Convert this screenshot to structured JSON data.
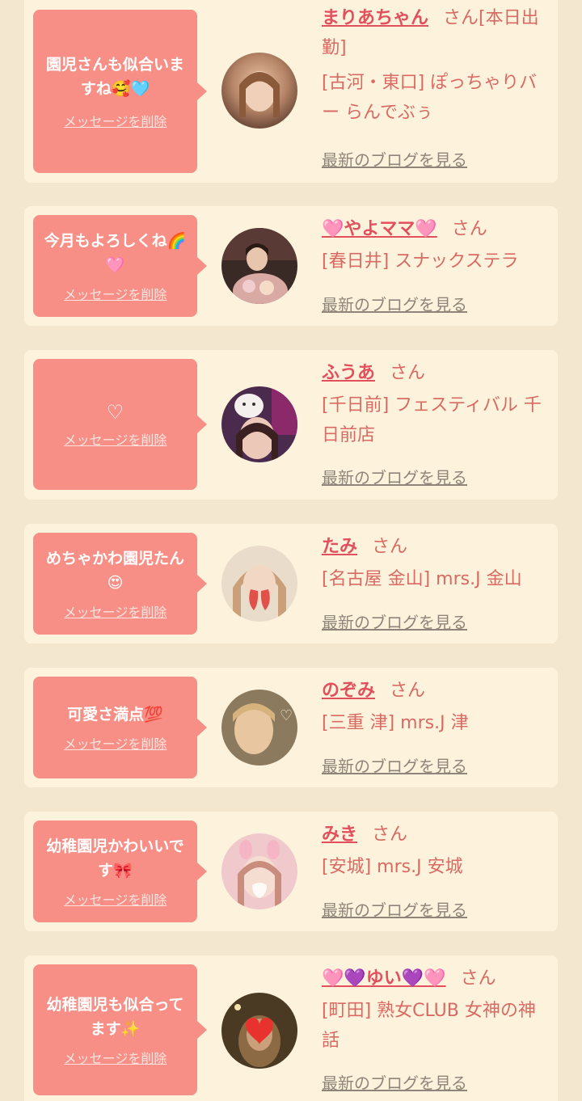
{
  "common": {
    "delete_label": "メッセージを削除",
    "blog_label": "最新のブログを見る",
    "honorific": "さん"
  },
  "items": [
    {
      "message": "園児さんも似合いますね🥰🩵",
      "name": "まりあちゃん",
      "honorific": "さん[本日出勤]",
      "shop": "[古河・東口] ぽっちゃりバー らんでぶぅ"
    },
    {
      "message": "今月もよろしくね🌈🩷",
      "name": "🩷やよママ🩷",
      "honorific": "さん",
      "shop": "[春日井] スナックステラ"
    },
    {
      "message": "♡",
      "name": "ふうあ",
      "honorific": "さん",
      "shop": "[千日前] フェスティバル 千日前店"
    },
    {
      "message": "めちゃかわ園児たん😍",
      "name": "たみ",
      "honorific": "さん",
      "shop": "[名古屋 金山] mrs.J 金山"
    },
    {
      "message": "可愛さ満点💯",
      "name": "のぞみ",
      "honorific": "さん",
      "shop": "[三重 津] mrs.J 津"
    },
    {
      "message": "幼稚園児かわいいです🎀",
      "name": "みき",
      "honorific": "さん",
      "shop": "[安城] mrs.J 安城"
    },
    {
      "message": "幼稚園児も似合ってます✨",
      "name": "🩷💜ゆい💜🩷",
      "honorific": "さん",
      "shop": "[町田] 熟女CLUB 女神の神話"
    }
  ],
  "colors": {
    "background": "#f4e7cf",
    "card": "#fdf3dc",
    "bubble": "#f88f86",
    "name": "#e24f5d",
    "text": "#d96a63",
    "blog_link": "#8f857a"
  }
}
